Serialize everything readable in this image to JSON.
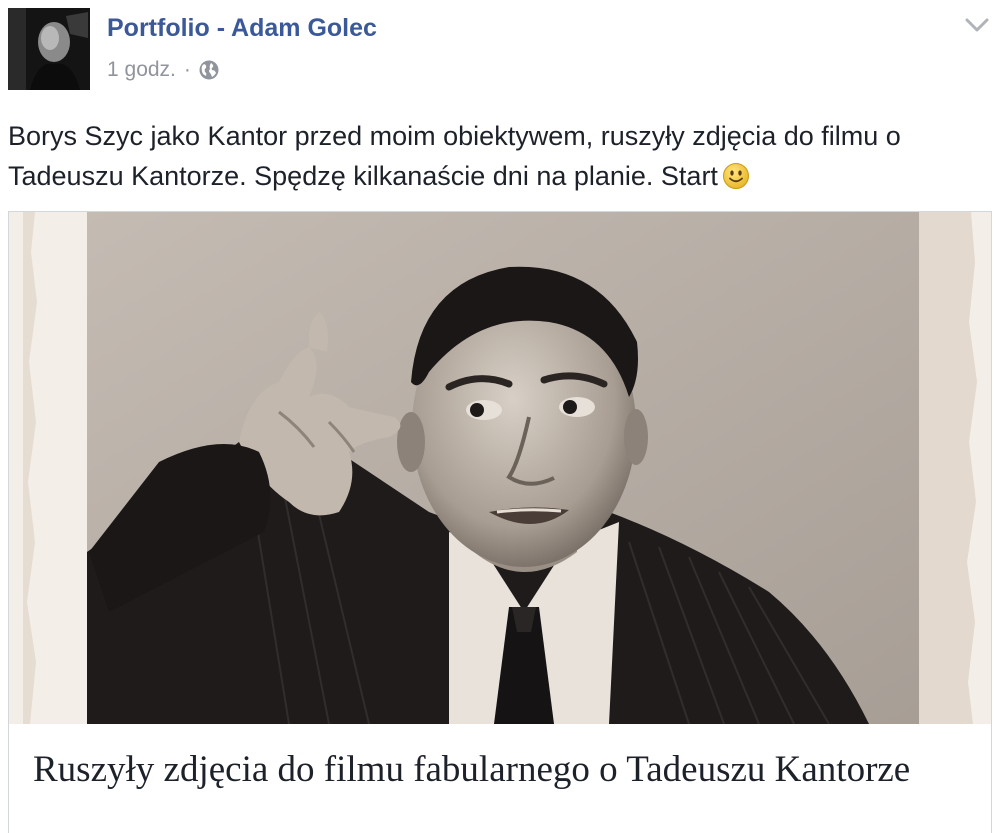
{
  "post": {
    "author": "Portfolio - Adam Golec",
    "timestamp": "1 godz.",
    "separator": "·",
    "audience_icon": "globe-icon",
    "menu_icon": "chevron-down-icon",
    "text": "Borys Szyc jako Kantor przed moim obiektywem, ruszyły zdjęcia do filmu o Tadeuszu Kantorze. Spędzę kilkanaście dni na planie. Start",
    "emoji": "smiley-emoji-icon"
  },
  "link_card": {
    "image_icon": "black-and-white-portrait-photo",
    "title": "Ruszyły zdjęcia do filmu fabularnego o Tadeuszu Kantorze"
  },
  "colors": {
    "author_link": "#3b5998",
    "meta_text": "#90949c",
    "body_text": "#1d2129",
    "card_border": "#d3d6db"
  }
}
